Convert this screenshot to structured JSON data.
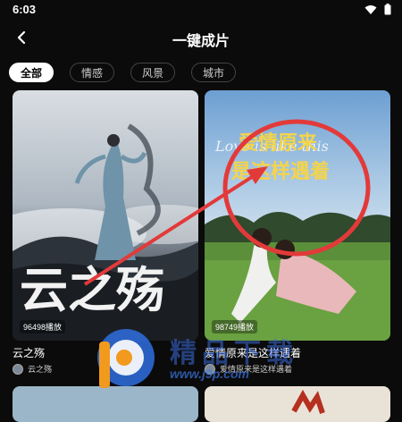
{
  "status": {
    "time": "6:03"
  },
  "header": {
    "title": "一键成片"
  },
  "tabs": [
    {
      "label": "全部",
      "active": true
    },
    {
      "label": "情感",
      "active": false
    },
    {
      "label": "风景",
      "active": false
    },
    {
      "label": "城市",
      "active": false
    }
  ],
  "cards": [
    {
      "cover_text": "云之殇",
      "play_count": "96498播放",
      "title": "云之殇",
      "author": "云之殇"
    },
    {
      "cover_text_line1": "爱情原来",
      "cover_text_line2": "是这样遇着",
      "cover_script": "Love is like this",
      "play_count": "98749播放",
      "title": "爱情原来是这样遇着",
      "author": "爱情原来是这样遇着"
    }
  ],
  "watermark": {
    "text": "精品下载",
    "url": "www.j9p.com"
  },
  "colors": {
    "accent_annotation": "#e23a3a",
    "background": "#0b0b0b"
  }
}
